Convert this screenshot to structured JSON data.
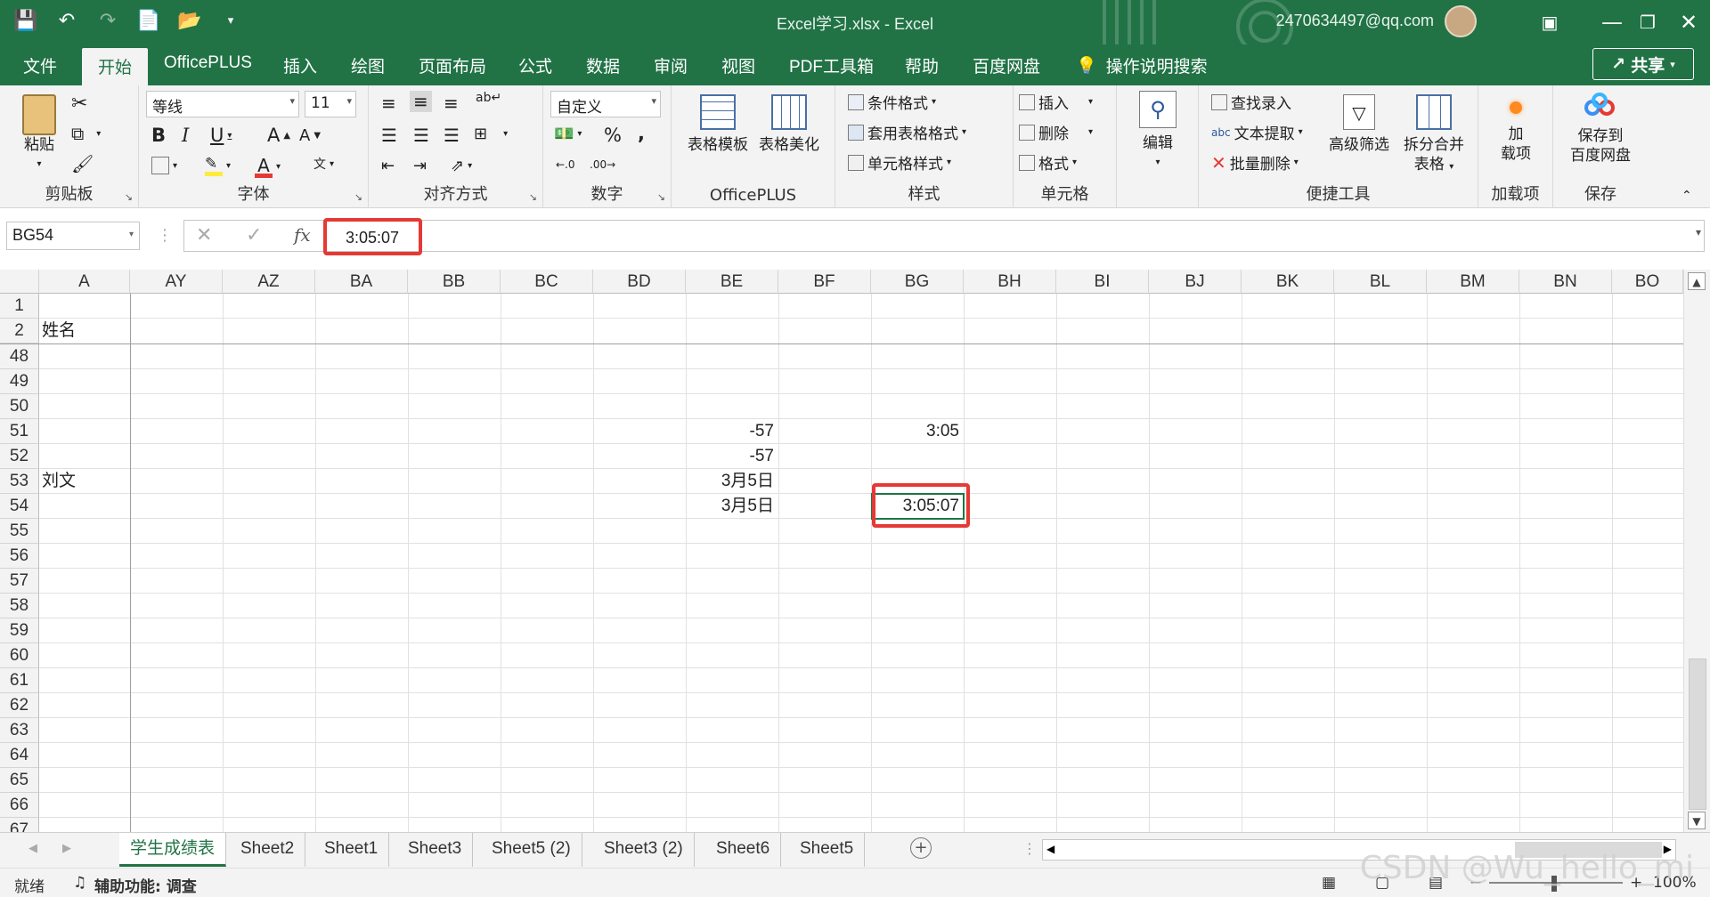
{
  "window": {
    "title": "Excel学习.xlsx  -  Excel",
    "account": "2470634497@qq.com"
  },
  "ribbon_tabs": [
    "文件",
    "开始",
    "OfficePLUS",
    "插入",
    "绘图",
    "页面布局",
    "公式",
    "数据",
    "审阅",
    "视图",
    "PDF工具箱",
    "帮助",
    "百度网盘"
  ],
  "active_tab": "开始",
  "tell_me": "操作说明搜索",
  "share": "共享",
  "ribbon": {
    "clipboard": {
      "label": "剪贴板",
      "paste": "粘贴"
    },
    "font": {
      "label": "字体",
      "name": "等线",
      "size": "11"
    },
    "alignment": {
      "label": "对齐方式"
    },
    "number": {
      "label": "数字",
      "format": "自定义"
    },
    "officeplus": {
      "label": "OfficePLUS",
      "table_template": "表格模板",
      "table_beautify": "表格美化"
    },
    "styles": {
      "label": "样式",
      "conditional": "条件格式",
      "table_format": "套用表格格式",
      "cell_style": "单元格样式"
    },
    "cells": {
      "label": "单元格",
      "insert": "插入",
      "delete": "删除",
      "format": "格式"
    },
    "editing": {
      "label": "编辑"
    },
    "quick_tools": {
      "label": "便捷工具",
      "find": "查找录入",
      "extract": "文本提取",
      "batch_delete": "批量删除",
      "adv_filter": "高级筛选",
      "split_merge": "拆分合并",
      "split_merge2": "表格"
    },
    "addins": {
      "label": "加载项",
      "btn1": "加",
      "btn2": "载项"
    },
    "save": {
      "label": "保存",
      "btn1": "保存到",
      "btn2": "百度网盘"
    }
  },
  "formula_bar": {
    "name_box": "BG54",
    "fx": "fx",
    "value": "3:05:07"
  },
  "columns": [
    "A",
    "AY",
    "AZ",
    "BA",
    "BB",
    "BC",
    "BD",
    "BE",
    "BF",
    "BG",
    "BH",
    "BI",
    "BJ",
    "BK",
    "BL",
    "BM",
    "BN",
    "BO"
  ],
  "rows": [
    "1",
    "2",
    "48",
    "49",
    "50",
    "51",
    "52",
    "53",
    "54",
    "55",
    "56",
    "57",
    "58",
    "59",
    "60",
    "61",
    "62",
    "63",
    "64",
    "65",
    "66",
    "67"
  ],
  "cells": {
    "A2": "姓名",
    "A53": "刘文",
    "BE51": "-57",
    "BE52": "-57",
    "BE53": "3月5日",
    "BE54": "3月5日",
    "BG51": "3:05",
    "BG54": "3:05:07"
  },
  "sheets": [
    "学生成绩表",
    "Sheet2",
    "Sheet1",
    "Sheet3",
    "Sheet5 (2)",
    "Sheet3 (2)",
    "Sheet6",
    "Sheet5"
  ],
  "active_sheet": "学生成绩表",
  "status": {
    "ready": "就绪",
    "accessibility": "辅助功能: 调查",
    "zoom": "100%"
  },
  "watermark": "CSDN @Wu_hello_mi",
  "colors": {
    "brand": "#217346",
    "highlight": "#e53935"
  }
}
